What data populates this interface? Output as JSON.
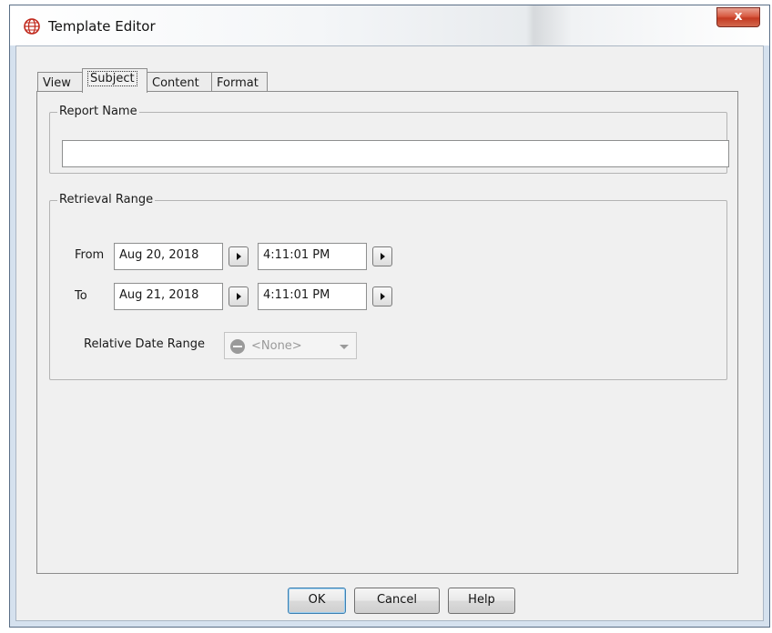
{
  "window": {
    "title": "Template Editor",
    "close_label": "x",
    "icon": "globe-icon",
    "accent_close": "#c43a22"
  },
  "tabs": [
    {
      "label": "View",
      "active": false
    },
    {
      "label": "Subject",
      "active": true
    },
    {
      "label": "Content",
      "active": false
    },
    {
      "label": "Format",
      "active": false
    }
  ],
  "report_name": {
    "group_label": "Report Name",
    "value": ""
  },
  "retrieval_range": {
    "group_label": "Retrieval Range",
    "from": {
      "label": "From",
      "date": "Aug 20, 2018",
      "time": "4:11:01 PM"
    },
    "to": {
      "label": "To",
      "date": "Aug 21, 2018",
      "time": "4:11:01 PM"
    },
    "relative": {
      "label": "Relative Date Range",
      "selected": "<None>",
      "enabled": false
    }
  },
  "buttons": {
    "ok": "OK",
    "cancel": "Cancel",
    "help": "Help"
  }
}
